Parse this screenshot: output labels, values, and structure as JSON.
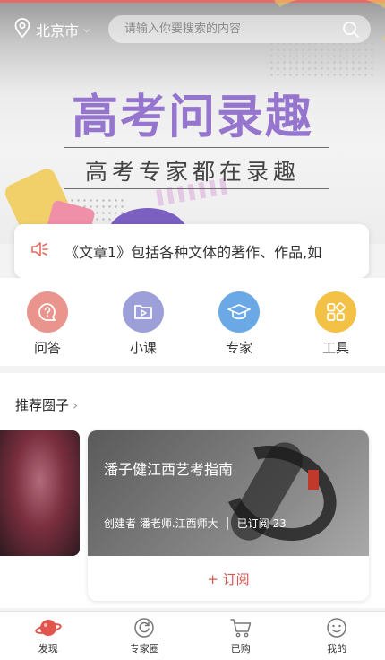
{
  "header": {
    "location": "北京市",
    "search_placeholder": "请输入你要搜索的内容"
  },
  "banner": {
    "title": "高考问录趣",
    "subtitle": "高考专家都在录趣"
  },
  "notice": {
    "text": "《文章1》包括各种文体的著作、作品,如"
  },
  "categories": [
    {
      "label": "问答",
      "color": "#e9948c"
    },
    {
      "label": "小课",
      "color": "#9d9fd8"
    },
    {
      "label": "专家",
      "color": "#6aa8e6"
    },
    {
      "label": "工具",
      "color": "#f2c145"
    }
  ],
  "recommend": {
    "title": "推荐圈子",
    "card": {
      "title": "潘子健江西艺考指南",
      "creator": "创建者 潘老师.江西师大",
      "subscribed": "已订阅 23",
      "subscribe_label": "+ 订阅"
    }
  },
  "bottom_nav": [
    {
      "label": "发现",
      "icon": "planet-icon"
    },
    {
      "label": "专家圈",
      "icon": "circle-refresh-icon"
    },
    {
      "label": "已购",
      "icon": "cart-icon"
    },
    {
      "label": "我的",
      "icon": "smiley-icon"
    }
  ],
  "colors": {
    "accent": "#d9534f",
    "banner_title": "#9575cd"
  }
}
